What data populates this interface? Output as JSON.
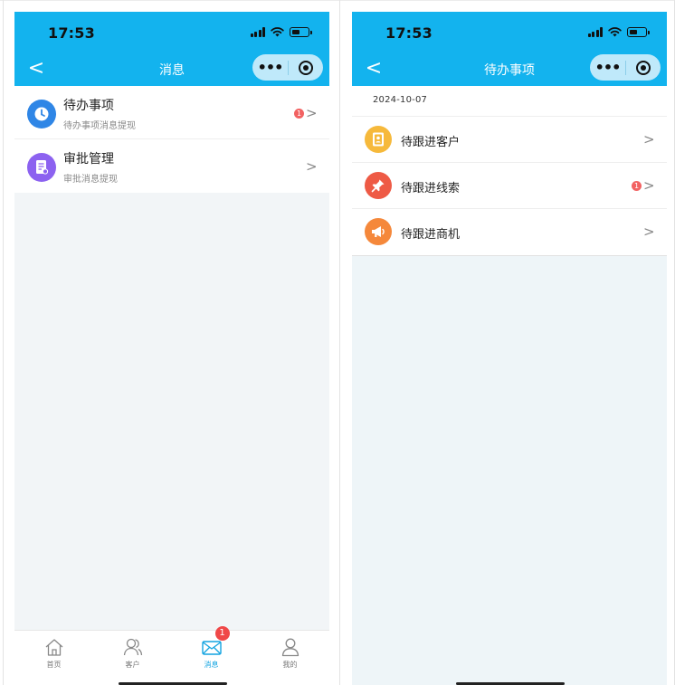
{
  "phones": [
    {
      "status_time": "17:53",
      "nav": {
        "back": "<",
        "title": "消息",
        "more": "•••"
      },
      "items": [
        {
          "title": "待办事项",
          "subtitle": "待办事项消息提现",
          "icon": "clock-icon",
          "color": "#2f86e6",
          "badge": "1"
        },
        {
          "title": "审批管理",
          "subtitle": "审批消息提现",
          "icon": "document-icon",
          "color": "#8c62f0",
          "badge": ""
        }
      ],
      "tabs": [
        {
          "label": "首页",
          "icon": "home-icon",
          "active": false
        },
        {
          "label": "客户",
          "icon": "customers-icon",
          "active": false
        },
        {
          "label": "消息",
          "icon": "mail-icon",
          "active": true,
          "badge": "1"
        },
        {
          "label": "我的",
          "icon": "profile-icon",
          "active": false
        }
      ]
    },
    {
      "status_time": "17:53",
      "nav": {
        "back": "<",
        "title": "待办事项",
        "more": "•••"
      },
      "date": "2024-10-07",
      "items": [
        {
          "title": "待跟进客户",
          "icon": "contact-card-icon",
          "color": "#f6b93b",
          "badge": ""
        },
        {
          "title": "待跟进线索",
          "icon": "pin-icon",
          "color": "#ee5a45",
          "badge": "1"
        },
        {
          "title": "待跟进商机",
          "icon": "megaphone-icon",
          "color": "#f5883b",
          "badge": ""
        }
      ]
    }
  ]
}
